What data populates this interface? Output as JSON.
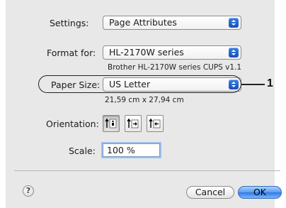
{
  "settings": {
    "label": "Settings:",
    "value": "Page Attributes"
  },
  "format_for": {
    "label": "Format for:",
    "value": "HL-2170W series",
    "description": "Brother HL-2170W series CUPS v1.1"
  },
  "paper_size": {
    "label": "Paper Size:",
    "value": "US Letter",
    "dimensions": "21,59 cm x 27,94 cm"
  },
  "orientation": {
    "label": "Orientation:",
    "options": [
      "portrait",
      "landscape-left",
      "landscape-right"
    ],
    "selected": "portrait"
  },
  "scale": {
    "label": "Scale:",
    "value": "100 %"
  },
  "buttons": {
    "help": "?",
    "cancel": "Cancel",
    "ok": "OK"
  },
  "callout": {
    "number": "1"
  },
  "colors": {
    "accent": "#2f7ae3",
    "dialog_bg": "#e8e8e8"
  }
}
